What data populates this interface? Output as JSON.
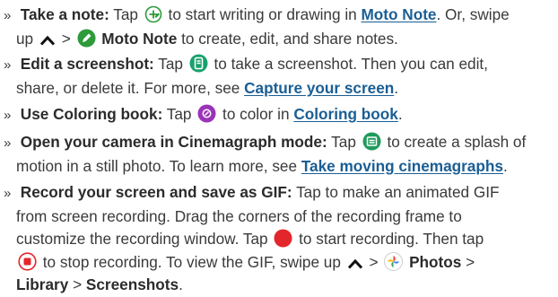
{
  "items": [
    {
      "title": "Take a note:",
      "t1": "Tap",
      "t2": "to start writing or drawing in",
      "link": "Moto Note",
      "t3": ". Or, swipe",
      "t4": "up",
      "t5": ">",
      "t6": "Moto Note",
      "t7": "to create, edit, and share notes."
    },
    {
      "title": "Edit a screenshot:",
      "t1": "Tap",
      "t2": "to take a screenshot. Then you can edit,",
      "t3": "share, or delete it. For more, see",
      "link": "Capture your screen",
      "t4": "."
    },
    {
      "title": "Use Coloring book:",
      "t1": "Tap",
      "t2": "to color in",
      "link": "Coloring book",
      "t3": "."
    },
    {
      "title": "Open your camera in Cinemagraph mode:",
      "t1": "Tap",
      "t2": "to create a splash of",
      "t3": "motion in a still photo. To learn more, see",
      "link": "Take moving cinemagraphs",
      "t4": "."
    },
    {
      "title": "Record your screen and save as GIF:",
      "t1": "Tap to make an animated GIF",
      "t2": "from screen recording. Drag the corners of the recording frame to",
      "t3": "customize the recording window. Tap",
      "t4": "to start recording. Then tap",
      "t5": "to stop recording. To view the GIF, swipe up",
      "t6": ">",
      "t7": "Photos",
      "t8": ">",
      "t9": "Library",
      "t10": ">",
      "t11": "Screenshots",
      "t12": "."
    }
  ],
  "bullet": "»",
  "icons": {
    "note_add": "note-add-icon",
    "pencil_app": "moto-note-app-icon",
    "screenshot": "screenshot-icon",
    "coloring": "coloring-book-icon",
    "cinemagraph": "cinemagraph-icon",
    "record": "record-icon",
    "stop": "stop-icon",
    "photos": "photos-app-icon",
    "chevron_up": "chevron-up-icon"
  },
  "colors": {
    "text": "#3a3a3a",
    "link": "#1a5e94",
    "note_green": "#2e9a3a",
    "moto_green": "#2e9a3a",
    "screenshot_green": "#1aa06d",
    "coloring_purple": "#9b35b8",
    "cinemagraph_green": "#1f9a5c",
    "record_red": "#e3262b"
  }
}
